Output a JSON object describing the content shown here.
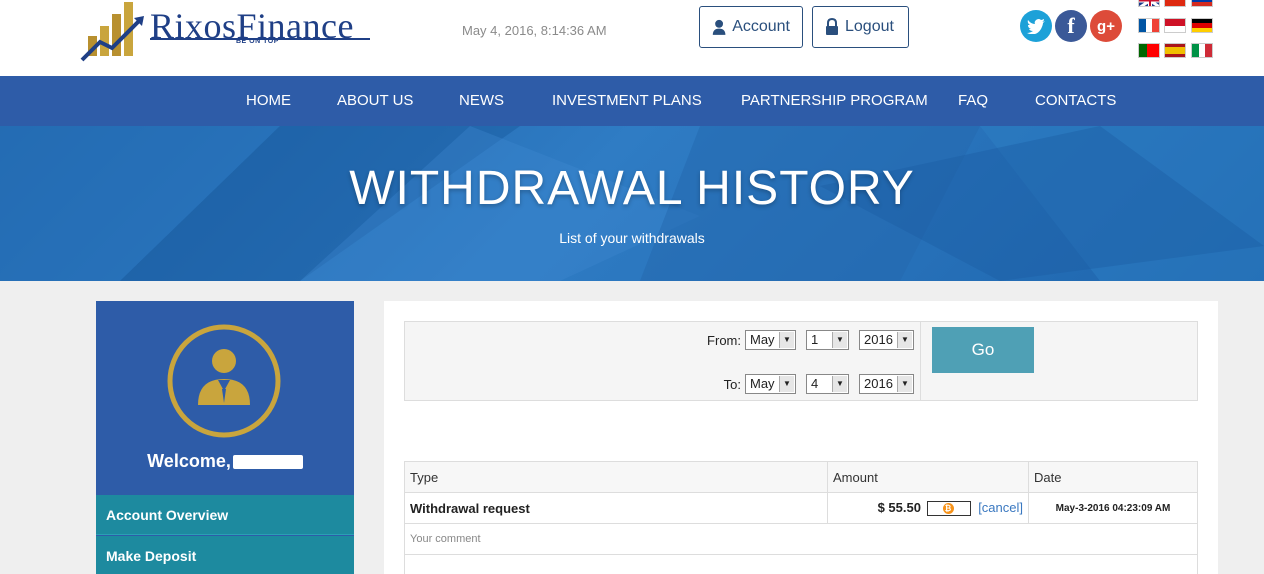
{
  "header": {
    "logo_brand_part1": "Rixos",
    "logo_brand_part2": "Finance",
    "logo_tagline": "BE ON TOP",
    "datetime": "May 4, 2016, 8:14:36 AM",
    "account_label": "Account",
    "logout_label": "Logout",
    "social": {
      "twitter": "twitter-icon",
      "facebook": "f",
      "google": "g+"
    }
  },
  "nav": {
    "items": [
      "HOME",
      "ABOUT US",
      "NEWS",
      "INVESTMENT PLANS",
      "PARTNERSHIP PROGRAM",
      "FAQ",
      "CONTACTS"
    ]
  },
  "banner": {
    "title": "WITHDRAWAL HISTORY",
    "subtitle": "List of your withdrawals"
  },
  "sidebar": {
    "welcome": "Welcome,",
    "links": [
      "Account Overview",
      "Make Deposit"
    ]
  },
  "filter": {
    "from_label": "From:",
    "to_label": "To:",
    "from": {
      "month": "May",
      "day": "1",
      "year": "2016"
    },
    "to": {
      "month": "May",
      "day": "4",
      "year": "2016"
    },
    "go_label": "Go"
  },
  "table": {
    "headers": [
      "Type",
      "Amount",
      "Date"
    ],
    "rows": [
      {
        "type": "Withdrawal request",
        "amount": "$ 55.50",
        "cancel": "[cancel]",
        "date": "May-3-2016 04:23:09 AM",
        "comment": "Your comment"
      }
    ]
  },
  "colors": {
    "nav_bg": "#2e5ca8",
    "sidebar_link": "#1d8a9f",
    "go_button": "#4fa0b5",
    "gold": "#c9a53d"
  }
}
